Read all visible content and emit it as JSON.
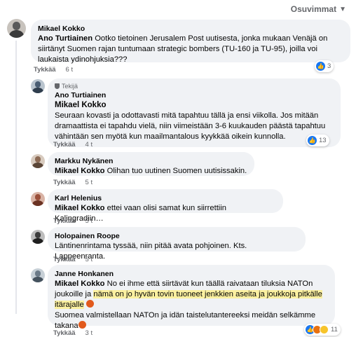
{
  "sort": {
    "label": "Osuvimmat"
  },
  "actions": {
    "like": "Tykkää",
    "reply": "Vastaa"
  },
  "comments": [
    {
      "author": "Mikael Kokko",
      "tag": "Ano Turtiainen",
      "text": " Ootko tietoinen Jerusalem Post uutisesta, jonka mukaan Venäjä on siirtänyt Suomen rajan tuntumaan strategic bombers (TU-160 ja TU-95), joilla voi laukaista ydinohjuksia???",
      "time": "6 t",
      "reactions": "3",
      "avatar_color": "#5a5a5a"
    },
    {
      "badge": "Tekijä",
      "author": "Ano Turtiainen",
      "tag": "Mikael Kokko",
      "text": "Seuraan kovasti ja odottavasti mitä tapahtuu tällä ja ensi viikolla. Jos mitään dramaattista ei tapahdu vielä, niin viimeistään 3-6 kuukauden päästä tapahtuu vähintään sen myötä kun maailmantalous kyykkää oikein kunnolla.",
      "time": "4 t",
      "reactions": "13",
      "avatar_color": "#4a5d73"
    },
    {
      "author": "Markku Nykänen",
      "tag": "Mikael Kokko",
      "text": " Olihan tuo uutinen Suomen uutisissakin.",
      "time": "5 t",
      "avatar_color": "#8c6a54"
    },
    {
      "author": "Karl Helenius",
      "tag": "Mikael Kokko",
      "text": " ettei vaan olisi samat kun siirrettiin Kalingradiin…",
      "time": "5 t",
      "avatar_color": "#9a4f3a"
    },
    {
      "author": "Holopainen Roope",
      "text": "Länt­inenrintama tyssää, niin pitää avata pohjoinen. Kts. Lappeenranta.",
      "time": "5 t",
      "avatar_color": "#3d3d3d"
    },
    {
      "author": "Janne Honkanen",
      "tag": "Mikael Kokko",
      "text_a": " No ei ihme että siirtävät kun täällä raivataan tiluksia NATOn joukoille ja ",
      "text_highlight": "nämä on jo hyvän tovin tuoneet jenkkien aseita ja joukkoja pitkälle itärajalle",
      "text_b": "Suomea valmistellaan NATOn ja idän taistelutantereeksi meidän selkämme takana",
      "time": "3 t",
      "reactions": "11",
      "avatar_color": "#6b7a88"
    }
  ]
}
